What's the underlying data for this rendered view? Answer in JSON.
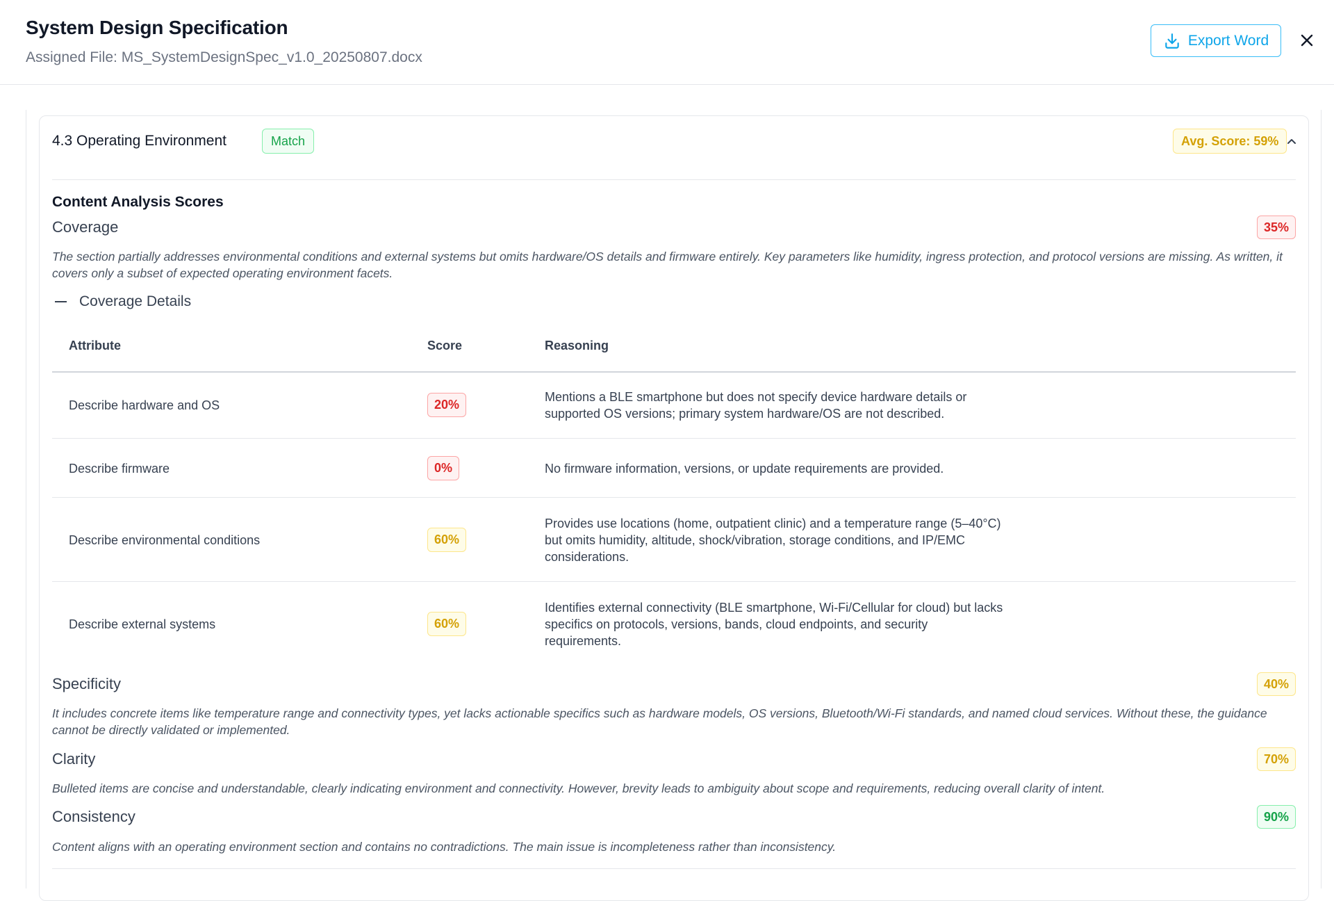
{
  "header": {
    "title": "System Design Specification",
    "assigned_file": "Assigned File: MS_SystemDesignSpec_v1.0_20250807.docx",
    "export_label": "Export Word"
  },
  "section": {
    "title": "4.3 Operating Environment",
    "status": "Match",
    "avg_score": "Avg. Score: 59%"
  },
  "analysis": {
    "heading": "Content Analysis Scores",
    "coverage": {
      "name": "Coverage",
      "score": "35%",
      "description": "The section partially addresses environmental conditions and external systems but omits hardware/OS details and firmware entirely. Key parameters like humidity, ingress protection, and protocol versions are missing. As written, it covers only a subset of expected operating environment facets.",
      "details_label": "Coverage Details",
      "columns": [
        "Attribute",
        "Score",
        "Reasoning"
      ],
      "rows": [
        {
          "attribute": "Describe hardware and OS",
          "score": "20%",
          "level": "red",
          "reasoning": "Mentions a BLE smartphone but does not specify device hardware details or supported OS versions; primary system hardware/OS are not described."
        },
        {
          "attribute": "Describe firmware",
          "score": "0%",
          "level": "red",
          "reasoning": "No firmware information, versions, or update requirements are provided."
        },
        {
          "attribute": "Describe environmental conditions",
          "score": "60%",
          "level": "yellow",
          "reasoning": "Provides use locations (home, outpatient clinic) and a temperature range (5–40°C) but omits humidity, altitude, shock/vibration, storage conditions, and IP/EMC considerations."
        },
        {
          "attribute": "Describe external systems",
          "score": "60%",
          "level": "yellow",
          "reasoning": "Identifies external connectivity (BLE smartphone, Wi-Fi/Cellular for cloud) but lacks specifics on protocols, versions, bands, cloud endpoints, and security requirements."
        }
      ]
    },
    "specificity": {
      "name": "Specificity",
      "score": "40%",
      "description": "It includes concrete items like temperature range and connectivity types, yet lacks actionable specifics such as hardware models, OS versions, Bluetooth/Wi-Fi standards, and named cloud services. Without these, the guidance cannot be directly validated or implemented."
    },
    "clarity": {
      "name": "Clarity",
      "score": "70%",
      "description": "Bulleted items are concise and understandable, clearly indicating environment and connectivity. However, brevity leads to ambiguity about scope and requirements, reducing overall clarity of intent."
    },
    "consistency": {
      "name": "Consistency",
      "score": "90%",
      "description": "Content aligns with an operating environment section and contains no contradictions. The main issue is incompleteness rather than inconsistency."
    }
  },
  "colors": {
    "accent": "#0ea5e9",
    "red": "#dc2626",
    "yellow": "#d4a106",
    "green": "#16a34a"
  },
  "icons": {
    "export": "download-icon",
    "close": "close-icon",
    "collapse": "chevron-up-icon",
    "details_toggle": "minus-icon"
  }
}
